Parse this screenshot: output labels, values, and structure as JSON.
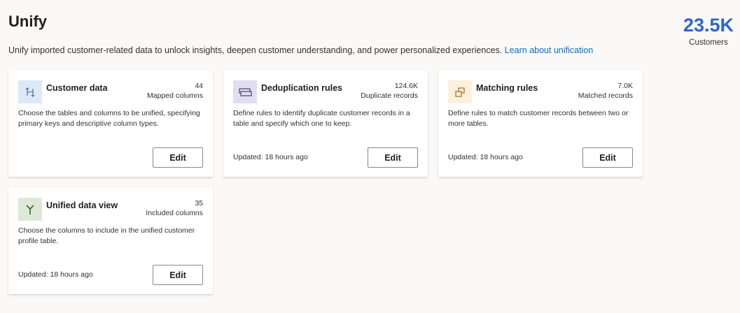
{
  "header": {
    "title": "Unify",
    "description": "Unify imported customer-related data to unlock insights, deepen customer understanding, and power personalized experiences.",
    "learn_link": "Learn about unification"
  },
  "kpi": {
    "value": "23.5K",
    "label": "Customers"
  },
  "colors": {
    "accent": "#2b66d0",
    "link": "#0f6cbd"
  },
  "cards": {
    "customer_data": {
      "title": "Customer data",
      "count": "44",
      "count_label": "Mapped columns",
      "description": "Choose the tables and columns to be unified, specifying primary keys and descriptive column types.",
      "updated": "",
      "edit": "Edit",
      "icon": "swap-icon",
      "icon_bg": "#dde9f7"
    },
    "dedup_rules": {
      "title": "Deduplication rules",
      "count": "124.6K",
      "count_label": "Duplicate records",
      "description": "Define rules to identify duplicate customer records in a table and specify which one to keep.",
      "updated": "Updated: 18 hours ago",
      "edit": "Edit",
      "icon": "stacked-records-icon",
      "icon_bg": "#e1def1"
    },
    "matching_rules": {
      "title": "Matching rules",
      "count": "7.0K",
      "count_label": "Matched records",
      "description": "Define rules to match customer records between two or more tables.",
      "updated": "Updated: 18 hours ago",
      "edit": "Edit",
      "icon": "overlapping-squares-icon",
      "icon_bg": "#fcf1dc"
    },
    "unified_view": {
      "title": "Unified data view",
      "count": "35",
      "count_label": "Included columns",
      "description": "Choose the columns to include in the unified customer profile table.",
      "updated": "Updated: 18 hours ago",
      "edit": "Edit",
      "icon": "merge-icon",
      "icon_bg": "#dde8d6"
    }
  }
}
